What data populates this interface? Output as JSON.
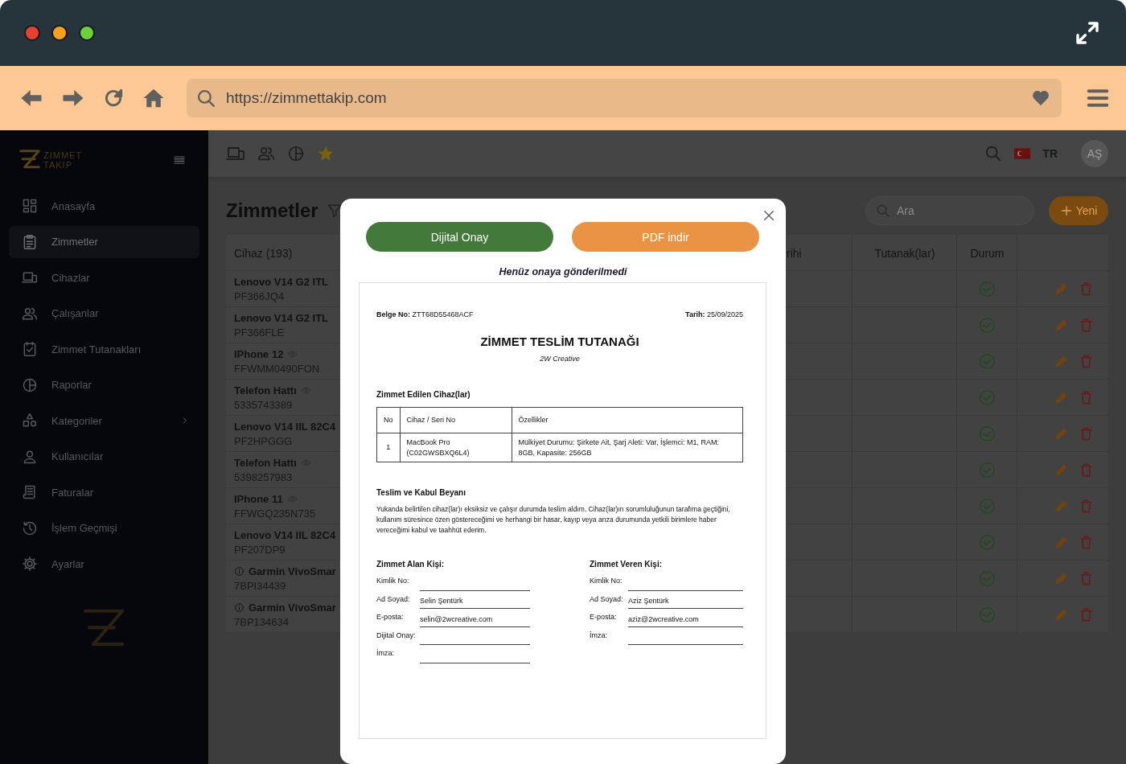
{
  "browser": {
    "url": "https://zimmettakip.com"
  },
  "sidebar": {
    "logo": [
      "ZIMMET",
      "TAKIP"
    ],
    "items": [
      {
        "label": "Anasayfa",
        "selected": false,
        "expandable": false
      },
      {
        "label": "Zimmetler",
        "selected": true,
        "expandable": false
      },
      {
        "label": "Cihazlar",
        "selected": false,
        "expandable": false
      },
      {
        "label": "Çalışanlar",
        "selected": false,
        "expandable": false
      },
      {
        "label": "Zimmet Tutanakları",
        "selected": false,
        "expandable": false
      },
      {
        "label": "Raporlar",
        "selected": false,
        "expandable": false
      },
      {
        "label": "Kategoriler",
        "selected": false,
        "expandable": true
      },
      {
        "label": "Kullanıcılar",
        "selected": false,
        "expandable": false
      },
      {
        "label": "Faturalar",
        "selected": false,
        "expandable": false
      },
      {
        "label": "İşlem Geçmişi",
        "selected": false,
        "expandable": false
      },
      {
        "label": "Ayarlar",
        "selected": false,
        "expandable": false
      }
    ]
  },
  "topbar": {
    "language": "TR",
    "avatar": "AŞ"
  },
  "page": {
    "title": "Zimmetler",
    "search": {
      "placeholder": "Ara"
    },
    "new_button": "Yeni"
  },
  "table": {
    "columns": [
      "Cihaz (193)",
      "rihi",
      "Tutanak(lar)",
      "Durum"
    ],
    "rows": [
      {
        "device": "Lenovo V14 G2 ITL",
        "serial": "PF366JQ4",
        "kind": "plain",
        "approved": true
      },
      {
        "device": "Lenovo V14 G2 ITL",
        "serial": "PF366FLE",
        "kind": "plain",
        "approved": true
      },
      {
        "device": "IPhone 12",
        "serial": "FFWMM0490FON",
        "kind": "viewable",
        "approved": true
      },
      {
        "device": "Telefon Hattı",
        "serial": "5335743389",
        "kind": "viewable",
        "approved": true
      },
      {
        "device": "Lenovo V14 IIL 82C4",
        "serial": "PF2HPGGG",
        "kind": "plain",
        "approved": true
      },
      {
        "device": "Telefon Hattı",
        "serial": "5398257983",
        "kind": "viewable",
        "approved": true
      },
      {
        "device": "IPhone 11",
        "serial": "FFWGQ235N735",
        "kind": "viewable",
        "approved": true
      },
      {
        "device": "Lenovo V14 IIL 82C4",
        "serial": "PF207DP9",
        "kind": "plain",
        "approved": true
      },
      {
        "device": "Garmin VivoSmar",
        "serial": "7BPI34439",
        "kind": "noted",
        "approved": true
      },
      {
        "device": "Garmin VivoSmar",
        "serial": "7BP134634",
        "kind": "noted",
        "approved": true
      }
    ]
  },
  "modal": {
    "buttons": [
      {
        "label": "Dijital Onay",
        "kind": "approve"
      },
      {
        "label": "PDF indir",
        "kind": "download"
      }
    ],
    "status": "Henüz onaya gönderilmedi",
    "document": {
      "doc_no": "**Belge No:** ZTT68D55468ACF",
      "date": "**Tarih:** 25/09/2025",
      "title": "ZİMMET TESLİM TUTANAĞI",
      "company": "2W Creative",
      "devices_title": "Zimmet Edilen Cihaz(lar)",
      "device_table": {
        "columns": [
          "No",
          "Cihaz / Seri No",
          "Özellikler"
        ],
        "rows": [
          [
            "1",
            "MacBook Pro (C02GWSBXQ6L4)",
            "Mülkiyet Durumu: Şirkete Ait, Şarj Aleti: Var, İşlemci: M1, RAM: 8GB, Kapasite: 256GB"
          ]
        ]
      },
      "declaration_title": "Teslim ve Kabul Beyanı",
      "declaration": "Yukanda belirtilen cihaz(lar)ı eksiksiz ve çalışır durumda teslim aldım. Cihaz(lar)ın sorumluluğunun tarafıma geçtiğini, kullanım süresince özen göstereceğimi ve herhangi bir hasar, kayıp veya arıza durumunda yetkili birimlere haber vereceğimi kabul ve taahhüt ederim.",
      "signatures": [
        {
          "title": "Zimmet Alan Kişi:",
          "fields": [
            {
              "label": "Kimlik No:"
            },
            {
              "label": "Ad Soyad:",
              "value": "Selin Şentürk"
            },
            {
              "label": "E-posta:",
              "value": "selin@2wcreative.com"
            },
            {
              "label": "Dijital Onay:"
            },
            {
              "label": "İmza:"
            }
          ]
        },
        {
          "title": "Zimmet Veren Kişi:",
          "fields": [
            {
              "label": "Kimlik No:"
            },
            {
              "label": "Ad Soyad:",
              "value": "Aziz Şentürk"
            },
            {
              "label": "E-posta:",
              "value": "aziz@2wcreative.com"
            },
            {
              "label": "İmza:"
            }
          ]
        }
      ]
    }
  }
}
